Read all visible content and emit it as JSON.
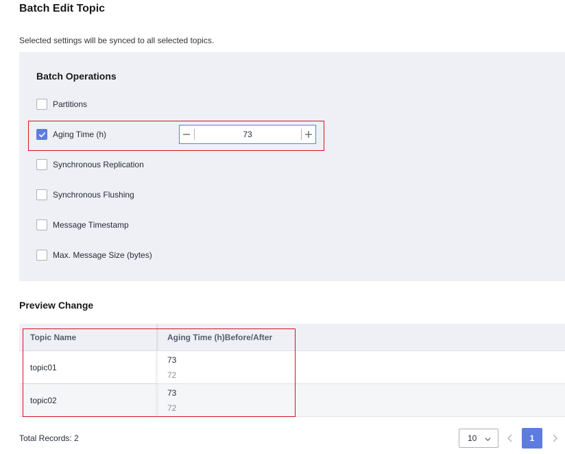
{
  "title": "Batch Edit Topic",
  "subtitle": "Selected settings will be synced to all selected topics.",
  "batch_ops": {
    "title": "Batch Operations",
    "items": [
      {
        "label": "Partitions",
        "checked": false
      },
      {
        "label": "Aging Time (h)",
        "checked": true
      },
      {
        "label": "Synchronous Replication",
        "checked": false
      },
      {
        "label": "Synchronous Flushing",
        "checked": false
      },
      {
        "label": "Message Timestamp",
        "checked": false
      },
      {
        "label": "Max. Message Size (bytes)",
        "checked": false
      }
    ],
    "aging_time_value": "73"
  },
  "preview": {
    "title": "Preview Change",
    "columns": [
      "Topic Name",
      "Aging Time (h)Before/After"
    ],
    "rows": [
      {
        "name": "topic01",
        "after": "73",
        "before": "72"
      },
      {
        "name": "topic02",
        "after": "73",
        "before": "72"
      }
    ]
  },
  "pagination": {
    "total": "Total Records: 2",
    "page_size": "10",
    "current_page": "1"
  },
  "colors": {
    "accent": "#5e7ce0",
    "highlight": "#d0121b",
    "panel_bg": "#eff0f5"
  }
}
